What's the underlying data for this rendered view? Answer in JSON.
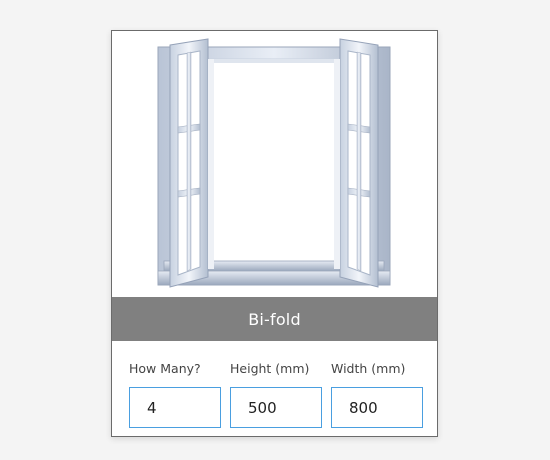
{
  "product": {
    "title": "Bi-fold",
    "image_icon": "open-bifold-window"
  },
  "fields": [
    {
      "label": "How Many?",
      "value": "4"
    },
    {
      "label": "Height (mm)",
      "value": "500"
    },
    {
      "label": "Width (mm)",
      "value": "800"
    }
  ],
  "colors": {
    "title_bar": "#808080",
    "input_border": "#4a9fe0",
    "card_border": "#6b6b6b"
  }
}
